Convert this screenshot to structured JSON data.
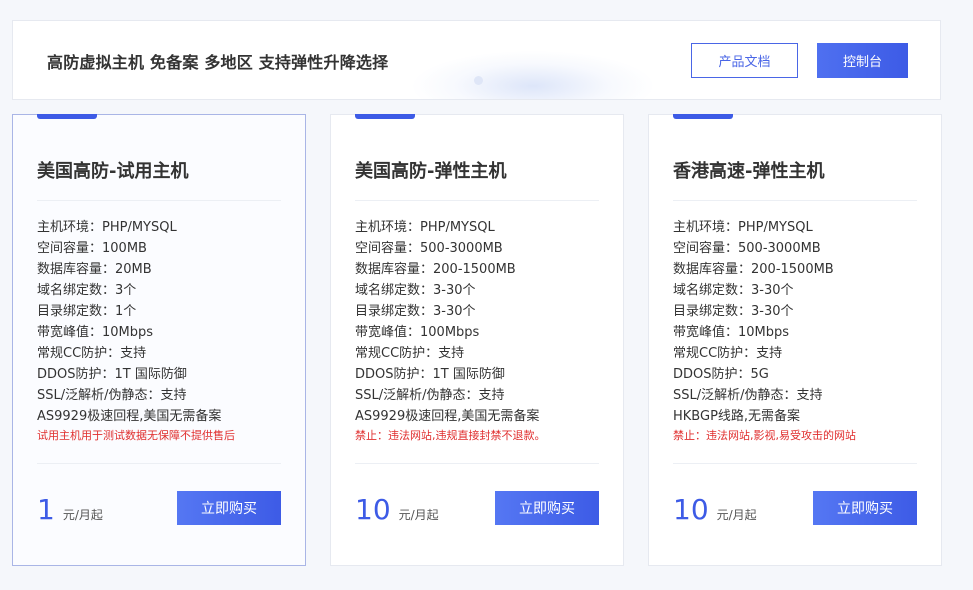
{
  "header": {
    "title": "高防虚拟主机 免备案 多地区 支持弹性升降选择",
    "docs_label": "产品文档",
    "console_label": "控制台"
  },
  "colors": {
    "accent": "#3d5be6",
    "warning": "#e02e2e"
  },
  "cards": [
    {
      "title": "美国高防-试用主机",
      "specs": [
        "主机环境：PHP/MYSQL",
        "空间容量：100MB",
        "数据库容量：20MB",
        "域名绑定数：3个",
        "目录绑定数：1个",
        "带宽峰值：10Mbps",
        "常规CC防护：支持",
        "DDOS防护：1T 国际防御",
        "SSL/泛解析/伪静态：支持",
        "AS9929极速回程,美国无需备案"
      ],
      "note": "试用主机用于测试数据无保障不提供售后",
      "price": "1",
      "unit": "元/月起",
      "buy_label": "立即购买"
    },
    {
      "title": "美国高防-弹性主机",
      "specs": [
        "主机环境：PHP/MYSQL",
        "空间容量：500-3000MB",
        "数据库容量：200-1500MB",
        "域名绑定数：3-30个",
        "目录绑定数：3-30个",
        "带宽峰值：100Mbps",
        "常规CC防护：支持",
        "DDOS防护：1T 国际防御",
        "SSL/泛解析/伪静态：支持",
        "AS9929极速回程,美国无需备案"
      ],
      "note": "禁止：违法网站,违规直接封禁不退款。",
      "price": "10",
      "unit": "元/月起",
      "buy_label": "立即购买"
    },
    {
      "title": "香港高速-弹性主机",
      "specs": [
        "主机环境：PHP/MYSQL",
        "空间容量：500-3000MB",
        "数据库容量：200-1500MB",
        "域名绑定数：3-30个",
        "目录绑定数：3-30个",
        "带宽峰值：10Mbps",
        "常规CC防护：支持",
        "DDOS防护：5G",
        "SSL/泛解析/伪静态：支持",
        "HKBGP线路,无需备案"
      ],
      "note": "禁止：违法网站,影视,易受攻击的网站",
      "price": "10",
      "unit": "元/月起",
      "buy_label": "立即购买"
    }
  ]
}
